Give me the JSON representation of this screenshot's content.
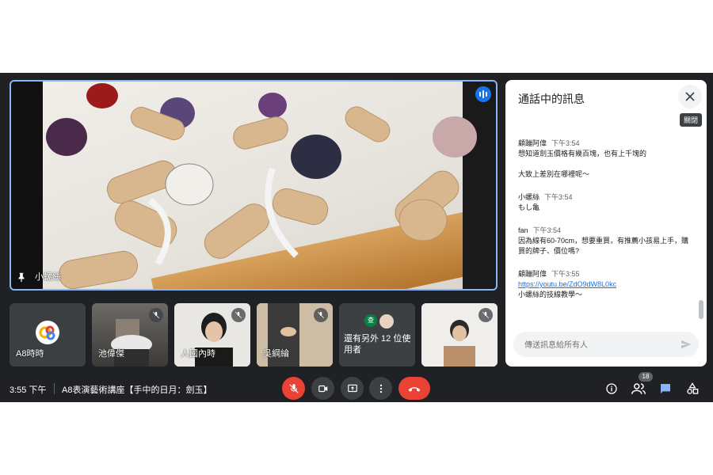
{
  "main_video": {
    "participant_name": "小螺絲"
  },
  "tiles": [
    {
      "name": "A8時時",
      "muted": false
    },
    {
      "name": "池偉傑",
      "muted": true
    },
    {
      "name": "人國內時",
      "muted": true
    },
    {
      "name": "吳綱綸",
      "muted": true
    },
    {
      "name": "還有另外 12 位使用者",
      "avatar_letter": "查"
    },
    {
      "name": "",
      "muted": true
    }
  ],
  "chat": {
    "title": "通話中的訊息",
    "close_tooltip": "關閉",
    "messages": [
      {
        "sender": "顧蹦阿偉",
        "time": "下午3:54",
        "lines": [
          "想知道劍玉價格有幾百塊，也有上千塊的",
          "",
          "大致上差別在哪裡呢～"
        ]
      },
      {
        "sender": "小螺絲",
        "time": "下午3:54",
        "lines": [
          "もし亀"
        ]
      },
      {
        "sender": "fan",
        "time": "下午3:54",
        "lines": [
          "因為線有60-70cm，想要重買，有推薦小孩易上手，購買的牌子、價位嗎?"
        ]
      },
      {
        "sender": "顧蹦阿偉",
        "time": "下午3:55",
        "link": "https://youtu.be/ZdO9dW8L0kc",
        "lines": [
          "小螺絲的技線教學～"
        ]
      }
    ],
    "input_placeholder": "傳送訊息給所有人"
  },
  "bottom_bar": {
    "time": "3:55 下午",
    "meeting_title": "A8表演藝術講座【手中的日月：劍玉】",
    "participants_count": "18"
  },
  "colors": {
    "accent": "#8ab4f8",
    "end_call": "#ea4335",
    "link": "#1a73e8",
    "bar_bg": "#202124"
  }
}
